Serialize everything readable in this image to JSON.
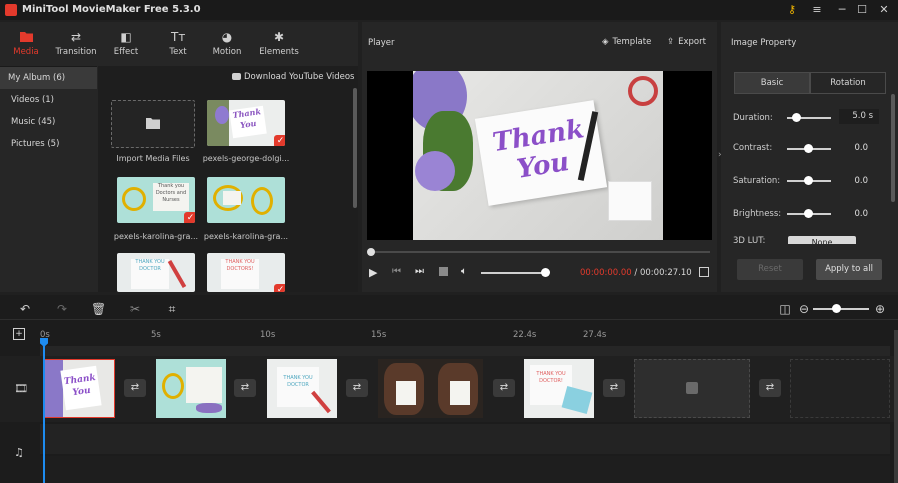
{
  "app": {
    "title": "MiniTool MovieMaker Free 5.3.0"
  },
  "toolbar": {
    "items": [
      {
        "label": "Media",
        "active": true,
        "icon": "folder-icon"
      },
      {
        "label": "Transition",
        "icon": "transition-icon"
      },
      {
        "label": "Effect",
        "icon": "effect-icon"
      },
      {
        "label": "Text",
        "icon": "text-icon"
      },
      {
        "label": "Motion",
        "icon": "motion-icon"
      },
      {
        "label": "Elements",
        "icon": "elements-icon"
      }
    ]
  },
  "sidebar": {
    "items": [
      {
        "label": "My Album (6)"
      },
      {
        "label": "Videos (1)"
      },
      {
        "label": "Music (45)"
      },
      {
        "label": "Pictures (5)"
      }
    ]
  },
  "media": {
    "download_link": "Download YouTube Videos",
    "import_label": "Import Media Files",
    "items": [
      {
        "label": "pexels-george-dolgi..."
      },
      {
        "label": "pexels-karolina-gra..."
      },
      {
        "label": "pexels-karolina-gra..."
      }
    ]
  },
  "player": {
    "title": "Player",
    "template_label": "Template",
    "export_label": "Export",
    "preview_text": "Thank You",
    "current_time": "00:00:00.00",
    "separator": " / ",
    "total_time": "00:00:27.10",
    "progress": 0.0,
    "volume": 0.8
  },
  "image_property": {
    "title": "Image Property",
    "tabs": [
      {
        "label": "Basic",
        "active": true
      },
      {
        "label": "Rotation"
      }
    ],
    "duration": {
      "label": "Duration:",
      "value": "5.0 s"
    },
    "contrast": {
      "label": "Contrast:",
      "value": "0.0"
    },
    "saturation": {
      "label": "Saturation:",
      "value": "0.0"
    },
    "brightness": {
      "label": "Brightness:",
      "value": "0.0"
    },
    "lut_label": "3D LUT:",
    "lut_value": "None",
    "reset_label": "Reset",
    "apply_label": "Apply to all"
  },
  "timeline": {
    "ticks": [
      "0s",
      "5s",
      "10s",
      "15s",
      "22.4s",
      "27.4s"
    ],
    "zoom": 0.5,
    "clip_texts": {
      "c1": "Thank You",
      "c3": "THANK YOU DOCTOR",
      "c5": "THANK YOU DOCTOR!"
    }
  },
  "colors": {
    "accent": "#e33a2c",
    "playhead": "#1e8cf0"
  }
}
